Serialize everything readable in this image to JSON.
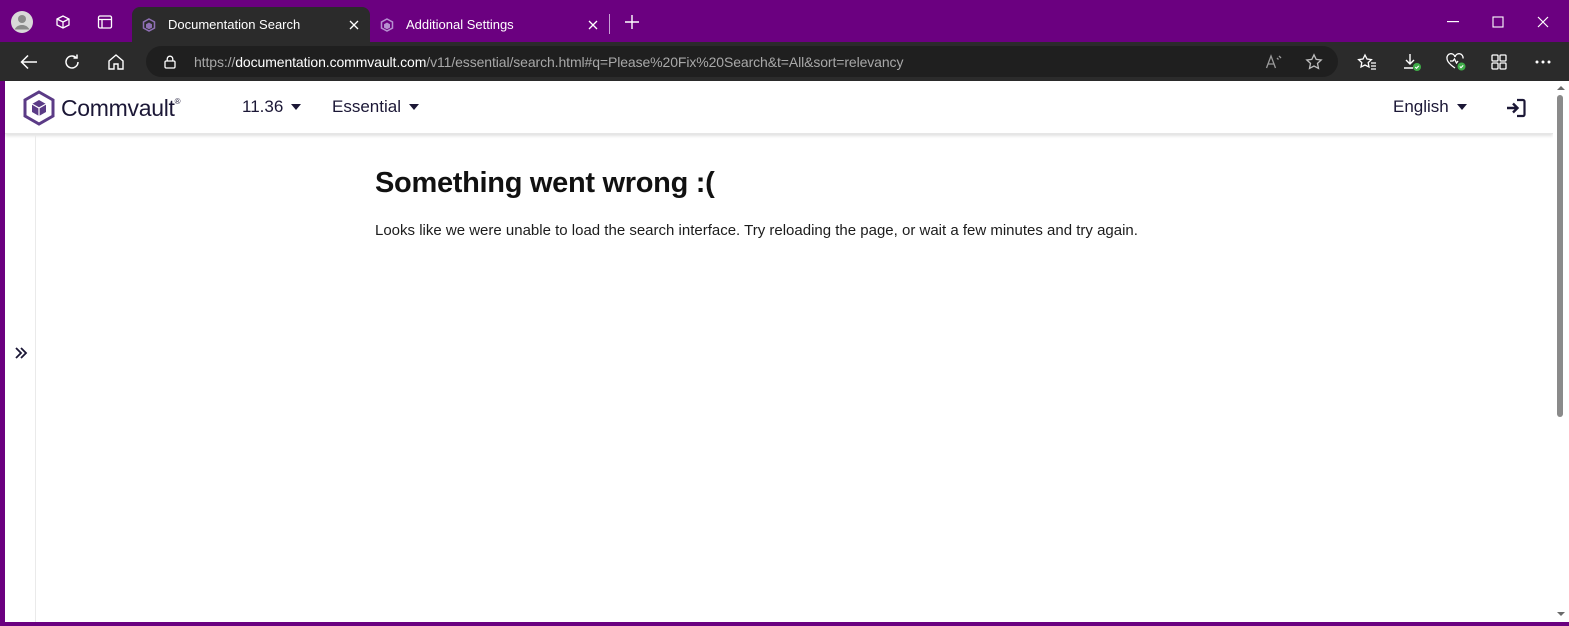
{
  "browser": {
    "tabs": [
      {
        "label": "Documentation Search",
        "active": true
      },
      {
        "label": "Additional Settings",
        "active": false
      }
    ],
    "url": {
      "scheme": "https://",
      "host": "documentation.commvault.com",
      "path": "/v11/essential/search.html#q=Please%20Fix%20Search&t=All&sort=relevancy"
    },
    "frame_color": "#6b0080"
  },
  "site": {
    "brand": "Commvault",
    "brand_mark": "®",
    "version": "11.36",
    "edition": "Essential",
    "language": "English",
    "brand_color": "#5b3b86"
  },
  "error": {
    "title": "Something went wrong :(",
    "message": "Looks like we were unable to load the search interface. Try reloading the page, or wait a few minutes and try again."
  }
}
